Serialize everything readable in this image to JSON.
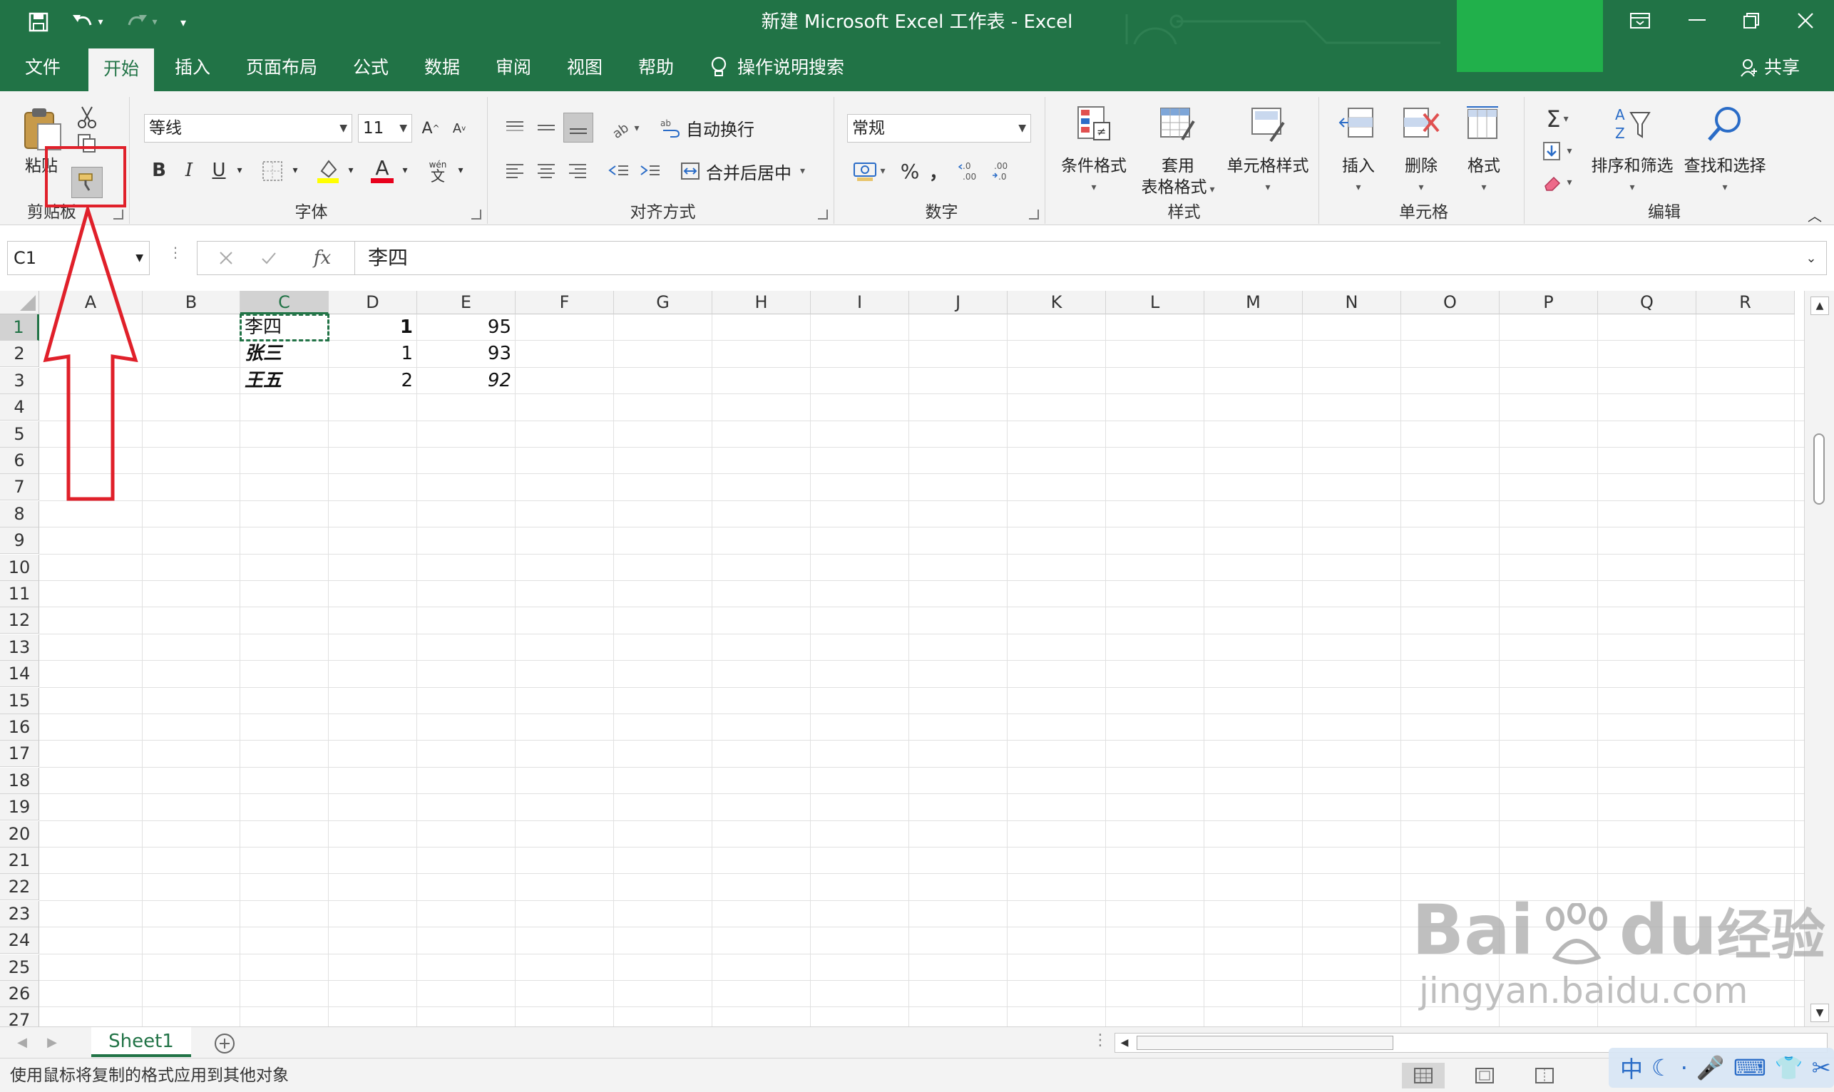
{
  "window": {
    "title": "新建 Microsoft Excel 工作表  -  Excel",
    "controls": [
      "restore-ribbon-icon",
      "minimize-icon",
      "restore-icon",
      "close-icon"
    ]
  },
  "quick_access": {
    "items": [
      "save-icon",
      "undo-icon",
      "redo-icon",
      "customize-icon"
    ]
  },
  "tabs": [
    {
      "label": "文件"
    },
    {
      "label": "开始",
      "active": true
    },
    {
      "label": "插入"
    },
    {
      "label": "页面布局"
    },
    {
      "label": "公式"
    },
    {
      "label": "数据"
    },
    {
      "label": "审阅"
    },
    {
      "label": "视图"
    },
    {
      "label": "帮助"
    }
  ],
  "search": {
    "label": "操作说明搜索"
  },
  "share": {
    "label": "共享"
  },
  "ribbon": {
    "clipboard": {
      "label": "剪贴板",
      "paste": "粘贴"
    },
    "font": {
      "label": "字体",
      "name": "等线",
      "size": "11",
      "bold": "B",
      "italic": "I",
      "underline": "U",
      "font_color_letter": "A",
      "phonetic_top": "wén",
      "phonetic_bottom": "文"
    },
    "alignment": {
      "label": "对齐方式",
      "wrap_text": "自动换行",
      "merge_center": "合并后居中"
    },
    "number": {
      "label": "数字",
      "format": "常规",
      "percent": "%",
      "comma": "，"
    },
    "styles": {
      "label": "样式",
      "conditional": "条件格式",
      "table_line1": "套用",
      "table_line2": "表格格式",
      "cell_styles": "单元格样式"
    },
    "cells": {
      "label": "单元格",
      "insert": "插入",
      "delete": "删除",
      "format": "格式"
    },
    "editing": {
      "label": "编辑",
      "sum": "Σ",
      "sort_filter": "排序和筛选",
      "find_select": "查找和选择"
    }
  },
  "formula_bar": {
    "name_box": "C1",
    "fx": "fx",
    "value": "李四"
  },
  "grid": {
    "columns": [
      "A",
      "B",
      "C",
      "D",
      "E",
      "F",
      "G",
      "H",
      "I",
      "J",
      "K",
      "L",
      "M",
      "N",
      "O",
      "P",
      "Q",
      "R"
    ],
    "rows": [
      "1",
      "2",
      "3",
      "4",
      "5",
      "6",
      "7",
      "8",
      "9",
      "10",
      "11",
      "12",
      "13",
      "14",
      "15",
      "16",
      "17",
      "18",
      "19",
      "20",
      "21",
      "22",
      "23",
      "24",
      "25",
      "26",
      "27"
    ],
    "selected_col": "C",
    "selected_row": "1",
    "cells": [
      {
        "col": "C",
        "row": 1,
        "text": "李四"
      },
      {
        "col": "D",
        "row": 1,
        "text": "1",
        "style": "bold",
        "num": true
      },
      {
        "col": "E",
        "row": 1,
        "text": "95",
        "num": true
      },
      {
        "col": "C",
        "row": 2,
        "text": "张三",
        "style": "bi"
      },
      {
        "col": "D",
        "row": 2,
        "text": "1",
        "num": true
      },
      {
        "col": "E",
        "row": 2,
        "text": "93",
        "num": true
      },
      {
        "col": "C",
        "row": 3,
        "text": "王五",
        "style": "bi"
      },
      {
        "col": "D",
        "row": 3,
        "text": "2",
        "num": true
      },
      {
        "col": "E",
        "row": 3,
        "text": "92",
        "style": "italic",
        "num": true
      }
    ]
  },
  "sheets": [
    {
      "name": "Sheet1",
      "active": true
    }
  ],
  "status": {
    "text": "使用鼠标将复制的格式应用到其他对象"
  },
  "watermark": {
    "line1": "Bai",
    "line1b": "du",
    "line1c": "经验",
    "line2": "jingyan.baidu.com",
    "ime": "中"
  },
  "colors": {
    "excel_green": "#217346",
    "annotation_red": "#e0202a",
    "accent_green": "#21b04b"
  }
}
